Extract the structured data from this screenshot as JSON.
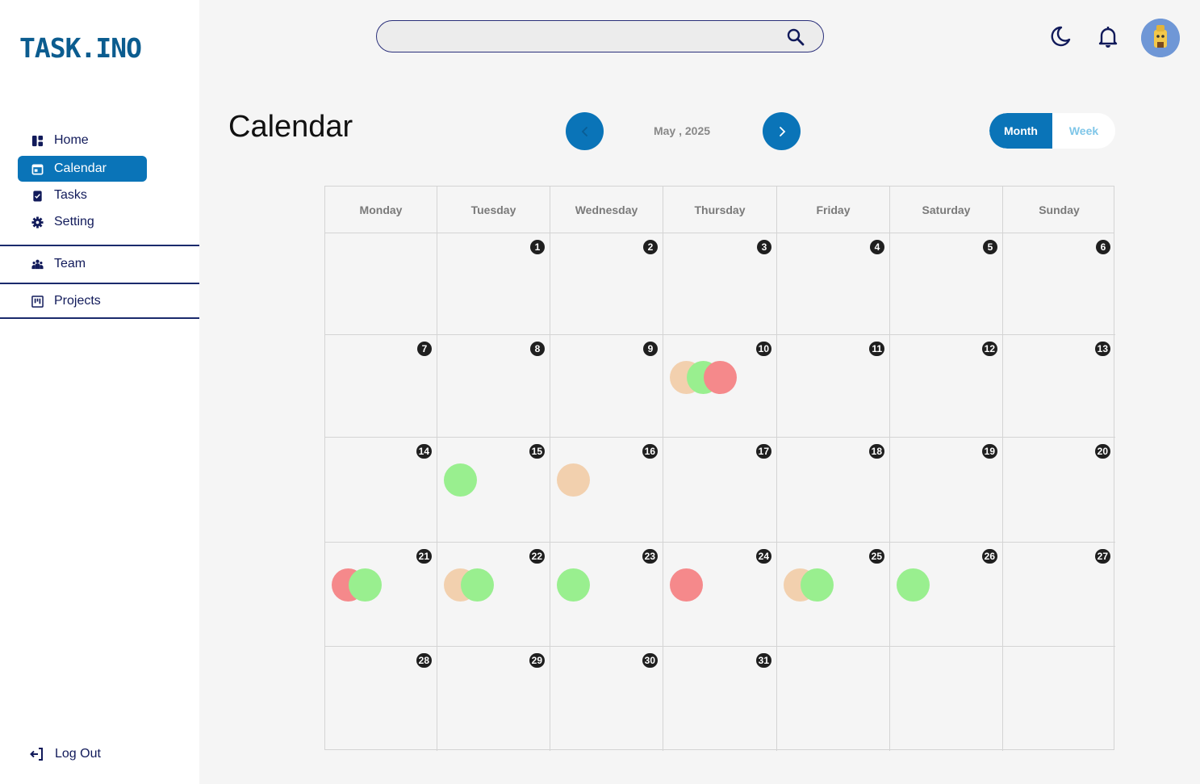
{
  "app": {
    "logo": "TASK.INO"
  },
  "sidebar": {
    "items": [
      {
        "label": "Home",
        "icon": "home-icon",
        "active": false
      },
      {
        "label": "Calendar",
        "icon": "calendar-icon",
        "active": true
      },
      {
        "label": "Tasks",
        "icon": "clipboard-icon",
        "active": false
      },
      {
        "label": "Setting",
        "icon": "gear-icon",
        "active": false
      }
    ],
    "group_items": [
      {
        "label": "Team",
        "icon": "team-icon"
      },
      {
        "label": "Projects",
        "icon": "kanban-icon"
      }
    ],
    "logout_label": "Log Out"
  },
  "search": {
    "placeholder": "",
    "value": ""
  },
  "header": {
    "title": "Calendar",
    "month_label": "May , 2025",
    "view_month": "Month",
    "view_week": "Week",
    "active_view": "Month"
  },
  "calendar": {
    "weekdays": [
      "Monday",
      "Tuesday",
      "Wednesday",
      "Thursday",
      "Friday",
      "Saturday",
      "Sunday"
    ],
    "first_weekday_index": 1,
    "days_in_month": 31,
    "events": {
      "10": [
        "peach",
        "green",
        "red"
      ],
      "15": [
        "green"
      ],
      "16": [
        "peach"
      ],
      "21": [
        "red",
        "green"
      ],
      "22": [
        "peach",
        "green"
      ],
      "23": [
        "green"
      ],
      "24": [
        "red"
      ],
      "25": [
        "peach",
        "green"
      ],
      "26": [
        "green"
      ]
    }
  },
  "colors": {
    "accent": "#0a74b8",
    "peach": "#f2d0ae",
    "green": "#99ef8f",
    "red": "#f5898b"
  }
}
